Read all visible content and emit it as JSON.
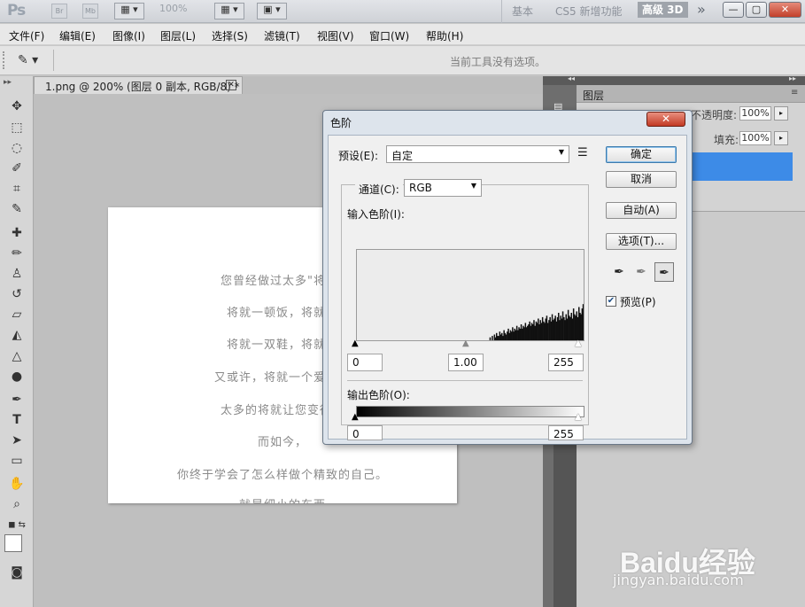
{
  "titlebar": {
    "logo": "Ps",
    "bridge": "Br",
    "minibridge": "Mb",
    "zoom": "100%",
    "workspaces": [
      "基本",
      "CS5 新增功能",
      "高级 3D"
    ],
    "overflow": "»",
    "window_buttons": [
      "—",
      "▢",
      "✕"
    ]
  },
  "menubar": [
    "文件(F)",
    "编辑(E)",
    "图像(I)",
    "图层(L)",
    "选择(S)",
    "滤镜(T)",
    "视图(V)",
    "窗口(W)",
    "帮助(H)"
  ],
  "options_bar": {
    "hint": "当前工具没有选项。"
  },
  "document": {
    "tab_title": "1.png @ 200% (图层 0 副本, RGB/8) *",
    "tab_close": "✕",
    "lines": [
      "您曾经做过太多\"将就\"",
      "将就一顿饭，将就一",
      "将就一双鞋，将就一",
      "又或许，将就一个爱人，",
      "太多的将就让您变得一",
      "而如今，",
      "你终于学会了怎么样做个精致的自己。",
      "就是细小的东西"
    ]
  },
  "layers_panel": {
    "tab": "图层",
    "opacity_label": "不透明度:",
    "opacity_value": "100%",
    "fill_label": "填充:",
    "fill_value": "100%"
  },
  "levels_dialog": {
    "title": "色阶",
    "close": "✕",
    "preset_label": "预设(E):",
    "preset_value": "自定",
    "channel_label": "通道(C):",
    "channel_value": "RGB",
    "input_label": "输入色阶(I):",
    "input_black": "0",
    "input_gamma": "1.00",
    "input_white": "255",
    "output_label": "输出色阶(O):",
    "output_black": "0",
    "output_white": "255",
    "buttons": {
      "ok": "确定",
      "cancel": "取消",
      "auto": "自动(A)",
      "options": "选项(T)..."
    },
    "preview_label": "预览(P)",
    "preview_checked": true,
    "histogram_profile": [
      0,
      0,
      0,
      0,
      0,
      0,
      0,
      0,
      0,
      0,
      0,
      0,
      0,
      0,
      0,
      0,
      0,
      0,
      0,
      0,
      0,
      0,
      0,
      0,
      0,
      0,
      0,
      0,
      0,
      0,
      0,
      0,
      0,
      0,
      0,
      0,
      0,
      0,
      0,
      0,
      0,
      0,
      0,
      0,
      0,
      0,
      0,
      0,
      0,
      0,
      0,
      0,
      0,
      0,
      0,
      0,
      0,
      0,
      0,
      0,
      0,
      0,
      0,
      0,
      0,
      0,
      0,
      0,
      0,
      0,
      0,
      0,
      0,
      0,
      0,
      0,
      0,
      0,
      0,
      0,
      0,
      0,
      0,
      0,
      0,
      0,
      0,
      0,
      0,
      0,
      0,
      0,
      0,
      0,
      0,
      0,
      0,
      0,
      0,
      0,
      0,
      0,
      0,
      0,
      0,
      0,
      0,
      0,
      0,
      0,
      0,
      0,
      0,
      0,
      0,
      0,
      0,
      0,
      0,
      0,
      0,
      0,
      0,
      0,
      0.02,
      0,
      0.03,
      0,
      0.04,
      0.02,
      0.05,
      0.03,
      0.03,
      0.06,
      0.04,
      0.05,
      0.03,
      0.07,
      0.05,
      0.04,
      0.06,
      0.08,
      0.05,
      0.07,
      0.06,
      0.09,
      0.06,
      0.08,
      0.07,
      0.1,
      0.07,
      0.09,
      0.08,
      0.11,
      0.08,
      0.1,
      0.09,
      0.12,
      0.09,
      0.1,
      0.11,
      0.13,
      0.1,
      0.12,
      0.11,
      0.14,
      0.1,
      0.13,
      0.12,
      0.15,
      0.11,
      0.14,
      0.12,
      0.16,
      0.13,
      0.12,
      0.15,
      0.17,
      0.12,
      0.14,
      0.16,
      0.13,
      0.18,
      0.14,
      0.15,
      0.17,
      0.13,
      0.16,
      0.19,
      0.14,
      0.17,
      0.15,
      0.2,
      0.16,
      0.14,
      0.18,
      0.15,
      0.21,
      0.17,
      0.16,
      0.19,
      0.15,
      0.22,
      0.18,
      0.17,
      0.2,
      0.16,
      0.23,
      0.19,
      0.18,
      0.22,
      0.25
    ]
  },
  "watermark": {
    "logo": "Baidu经验",
    "url": "jingyan.baidu.com"
  }
}
